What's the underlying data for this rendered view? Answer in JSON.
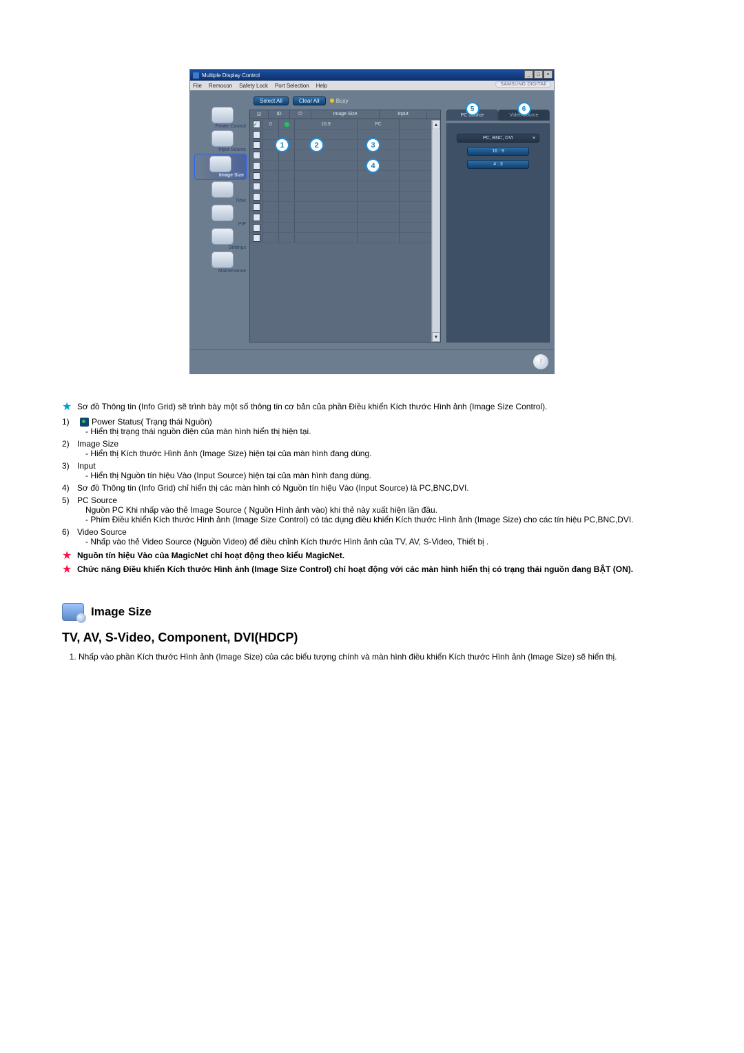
{
  "window": {
    "title": "Multiple Display Control",
    "menu": [
      "File",
      "Remocon",
      "Safety Lock",
      "Port Selection",
      "Help"
    ],
    "brand": "SAMSUNG DIGITAll"
  },
  "toolbar": {
    "select_all": "Select All",
    "clear_all": "Clear All",
    "busy": "Busy"
  },
  "sidebar": {
    "items": [
      {
        "label": "Power Control"
      },
      {
        "label": "Input Source"
      },
      {
        "label": "Image Size"
      },
      {
        "label": "Time"
      },
      {
        "label": "PIP"
      },
      {
        "label": "Settings"
      },
      {
        "label": "Maintenance"
      }
    ]
  },
  "grid": {
    "headers": {
      "chk": "",
      "id": "ID",
      "pwr": "",
      "size": "Image Size",
      "input": "Input"
    },
    "row0": {
      "id": "0",
      "size": "16:9",
      "input": "PC"
    }
  },
  "tabs": {
    "pc": "PC Source",
    "video": "Video Source"
  },
  "panel": {
    "dropdown": "PC, BNC, DVI",
    "opt1": "16 : 9",
    "opt2": "4 : 3"
  },
  "callouts": {
    "c1": "1",
    "c2": "2",
    "c3": "3",
    "c4": "4",
    "c5": "5",
    "c6": "6"
  },
  "notes": {
    "intro": "Sơ đồ Thông tin (Info Grid) sẽ trình bày một số thông tin cơ bản của phần Điều khiển Kích thước Hình ảnh (Image Size Control).",
    "n1_head": "Power Status( Trạng thái Nguồn)",
    "n1_sub": "- Hiển thị trạng thái nguồn điện của màn hình hiển thị hiện tại.",
    "n2_head": "Image Size",
    "n2_sub": "- Hiển thị Kích thước Hình ảnh (Image Size) hiện tại của màn hình đang dùng.",
    "n3_head": "Input",
    "n3_sub": "- Hiển thị Nguồn tín hiệu Vào (Input Source) hiện tại của màn hình đang dùng.",
    "n4": "Sơ đồ Thông tin (Info Grid) chỉ hiển thị các màn hình có Nguồn tín hiệu Vào (Input Source) là PC,BNC,DVI.",
    "n5_head": "PC Source",
    "n5_a": "Nguồn PC Khi nhấp vào thẻ Image Source ( Nguồn Hình ảnh vào) khi thẻ này xuất hiện lần đầu.",
    "n5_b": "- Phím Điều khiển Kích thước Hình ảnh (Image Size Control) có tác dụng điều khiển Kích thước Hình ảnh (Image Size) cho các tín hiệu PC,BNC,DVI.",
    "n6_head": "Video Source",
    "n6_sub": "- Nhấp vào thẻ Video Source (Nguồn Video) để điều chỉnh Kích thước Hình ảnh của TV, AV, S-Video, Thiết bị .",
    "star1": "Nguồn tín hiệu Vào của MagicNet chỉ hoạt động theo kiểu MagicNet.",
    "star2": "Chức năng Điều khiển Kích thước Hình ảnh (Image Size Control) chỉ hoạt động với các màn hình hiển thị có trạng thái nguồn đang BẬT (ON)."
  },
  "section": {
    "title": "Image Size",
    "sub": "TV, AV, S-Video, Component, DVI(HDCP)",
    "li1": "Nhấp vào phần Kích thước Hình ảnh (Image Size) của các biểu tượng chính và màn hình điều khiển Kích thước Hình ảnh (Image Size) sẽ hiển thị."
  }
}
